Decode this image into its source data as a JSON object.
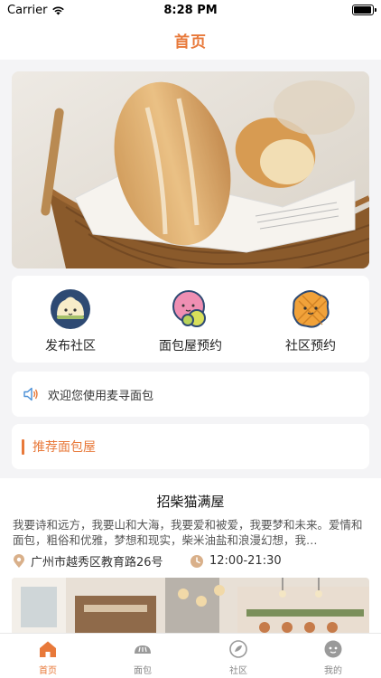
{
  "status_bar": {
    "carrier": "Carrier",
    "time": "8:28 PM"
  },
  "nav": {
    "title": "首页"
  },
  "banner": {
    "image": "bread-in-basket-photo"
  },
  "quick_entries": [
    {
      "label": "发布社区",
      "icon": "steamed-bun-icon"
    },
    {
      "label": "面包屋预约",
      "icon": "mochi-icon"
    },
    {
      "label": "社区预约",
      "icon": "waffle-icon"
    }
  ],
  "notice": {
    "icon": "speaker-icon",
    "text": "欢迎您使用麦寻面包"
  },
  "section": {
    "title": "推荐面包屋"
  },
  "bakery": {
    "name": "招柴猫满屋",
    "description": "我要诗和远方，我要山和大海，我要爱和被爱，我要梦和未来。爱情和面包，粗俗和优雅，梦想和现实，柴米油盐和浪漫幻想，我…",
    "address": "广州市越秀区教育路26号",
    "hours": "12:00-21:30"
  },
  "tabs": [
    {
      "label": "首页",
      "icon": "home-icon",
      "active": true
    },
    {
      "label": "面包",
      "icon": "bread-icon",
      "active": false
    },
    {
      "label": "社区",
      "icon": "community-icon",
      "active": false
    },
    {
      "label": "我的",
      "icon": "profile-icon",
      "active": false
    }
  ],
  "colors": {
    "accent": "#e8793a",
    "background": "#f4f4f6"
  }
}
